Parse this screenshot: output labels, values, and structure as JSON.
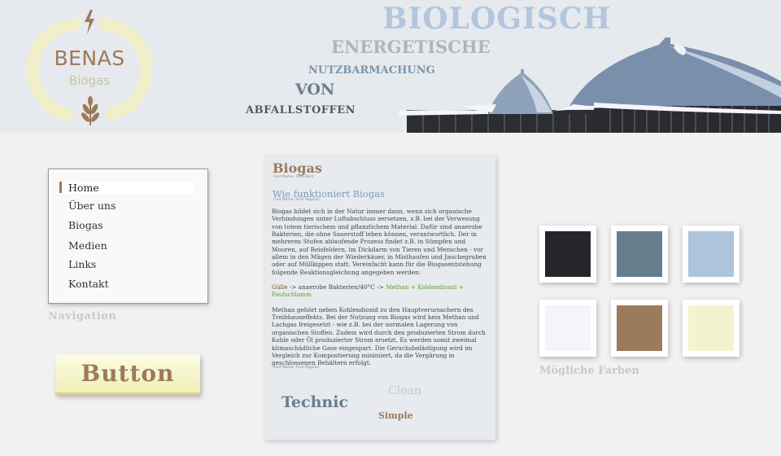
{
  "logo": {
    "name": "BENAS",
    "subtitle": "Biogas",
    "colors": {
      "arc": "#f0efc8",
      "text": "#9c7a5b",
      "sub": "#c5c5a6"
    },
    "icons": [
      "lightning-icon",
      "wheat-icon"
    ]
  },
  "headline": {
    "line1": "BIOLOGISCH",
    "line2": "ENERGETISCHE",
    "line3": "NUTZBARMACHUNG",
    "line4": "VON",
    "line5": "ABFALLSTOFFEN"
  },
  "navigation": {
    "items": [
      {
        "label": "Home",
        "active": true
      },
      {
        "label": "Über uns",
        "active": false
      },
      {
        "label": "Biogas",
        "active": false
      },
      {
        "label": "Medien",
        "active": false
      },
      {
        "label": "Links",
        "active": false
      },
      {
        "label": "Kontakt",
        "active": false
      }
    ],
    "caption": "Navigation"
  },
  "button": {
    "label": "Button"
  },
  "card": {
    "title": "Biogas",
    "title_font_note": "Font Name: Arvo Bold",
    "subtitle": "Wie funktioniert Biogas",
    "subtitle_font_note": "Font Name: Arvo Regular",
    "paragraph1": "Biogas bildet sich in der Natur immer dann, wenn sich organische Verbindungen unter Luftabschluss zersetzen, z.B. bei der Verwesung von totem tierischem und pflanzlichem Material. Dafür sind anaerobe Bakterien, die ohne Sauerstoff leben können, verantwortlich. Der in mehreren Stufen ablaufende Prozess findet z.B. in Sümpfen und Mooren, auf Reisfeldern, im Dickdarm von Tieren und Menschen - vor allem in den Mägen der Wiederkäuer, in Misthaufen und Jauchegruben oder auf Müllkippen statt. Vereinfacht kann für die Biogasentstehung folgende Reaktionsgleichung angegeben werden:",
    "formula": {
      "input": "Gülle",
      "process": " -> anaerobe Bakterien/40°C -> ",
      "output": "Methan + Kohlendioxid + Faulschlamm"
    },
    "paragraph2": "Methan gehört neben Kohlendioxid zu den Hauptverursachern des Treibhauseffekts. Bei der Nutzung von Biogas wird kein Methan und Lachgas freigesetzt - wie z.B. bei der normalen Lagerung von organischen Stoffen. Zudem wird durch den produzierten Strom durch Kohle oder Öl produzierter Strom ersetzt. Es werden somit zweimal klimaschädliche Gase eingespart. Die Geruchsbelästigung wird im Vergleich zur Kompostierung minimiert, da die Vergärung in geschlossenen Behältern erfolgt.",
    "body_font_note": "Font Name: Arvo Regular",
    "style_words": {
      "technic": "Technic",
      "clean": "Clean",
      "simple": "Simple"
    }
  },
  "palette": {
    "caption": "Mögliche Farben",
    "colors": [
      "#25252b",
      "#677d8c",
      "#aec4dc",
      "#f3f5f9",
      "#9c7b5d",
      "#f3f4cf"
    ]
  }
}
